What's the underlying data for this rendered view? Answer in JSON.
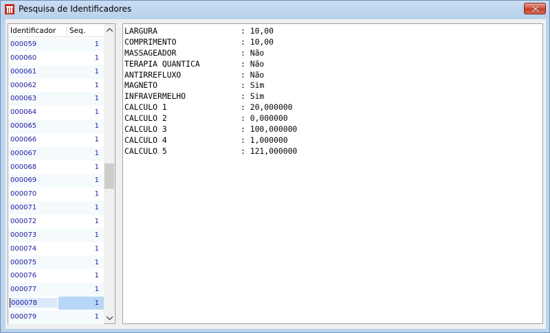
{
  "window": {
    "title": "Pesquisa de Identificadores"
  },
  "list": {
    "columns": {
      "id": "Identificador",
      "seq": "Seq."
    },
    "rows": [
      {
        "id": "000059",
        "seq": "1"
      },
      {
        "id": "000060",
        "seq": "1"
      },
      {
        "id": "000061",
        "seq": "1"
      },
      {
        "id": "000062",
        "seq": "1"
      },
      {
        "id": "000063",
        "seq": "1"
      },
      {
        "id": "000064",
        "seq": "1"
      },
      {
        "id": "000065",
        "seq": "1"
      },
      {
        "id": "000066",
        "seq": "1"
      },
      {
        "id": "000067",
        "seq": "1"
      },
      {
        "id": "000068",
        "seq": "1"
      },
      {
        "id": "000069",
        "seq": "1"
      },
      {
        "id": "000070",
        "seq": "1"
      },
      {
        "id": "000071",
        "seq": "1"
      },
      {
        "id": "000072",
        "seq": "1"
      },
      {
        "id": "000073",
        "seq": "1"
      },
      {
        "id": "000074",
        "seq": "1"
      },
      {
        "id": "000075",
        "seq": "1"
      },
      {
        "id": "000076",
        "seq": "1"
      },
      {
        "id": "000077",
        "seq": "1"
      },
      {
        "id": "000078",
        "seq": "1",
        "selected": true
      },
      {
        "id": "000079",
        "seq": "1"
      }
    ]
  },
  "details": [
    {
      "key": "LARGURA",
      "value": ": 10,00"
    },
    {
      "key": "COMPRIMENTO",
      "value": ": 10,00"
    },
    {
      "key": "MASSAGEADOR",
      "value": ": Não"
    },
    {
      "key": "TERAPIA QUANTICA",
      "value": ": Não"
    },
    {
      "key": "ANTIRREFLUXO",
      "value": ": Não"
    },
    {
      "key": "MAGNETO",
      "value": ": Sim"
    },
    {
      "key": "INFRAVERMELHO",
      "value": ": Sim"
    },
    {
      "key": "CALCULO 1",
      "value": ": 20,000000"
    },
    {
      "key": "CALCULO 2",
      "value": ": 0,000000"
    },
    {
      "key": "CALCULO 3",
      "value": ": 100,000000"
    },
    {
      "key": "CALCULO 4",
      "value": ": 1,000000"
    },
    {
      "key": "CALCULO 5",
      "value": ": 121,000000"
    }
  ],
  "icons": {
    "app": "app-logo-icon",
    "close": "close-icon",
    "scroll_up": "scroll-up-arrow-icon",
    "scroll_down": "scroll-down-arrow-icon"
  },
  "colors": {
    "accent_row_text": "#1a1aa0",
    "selection": "#b8d6f5",
    "close_button": "#c9432d"
  }
}
